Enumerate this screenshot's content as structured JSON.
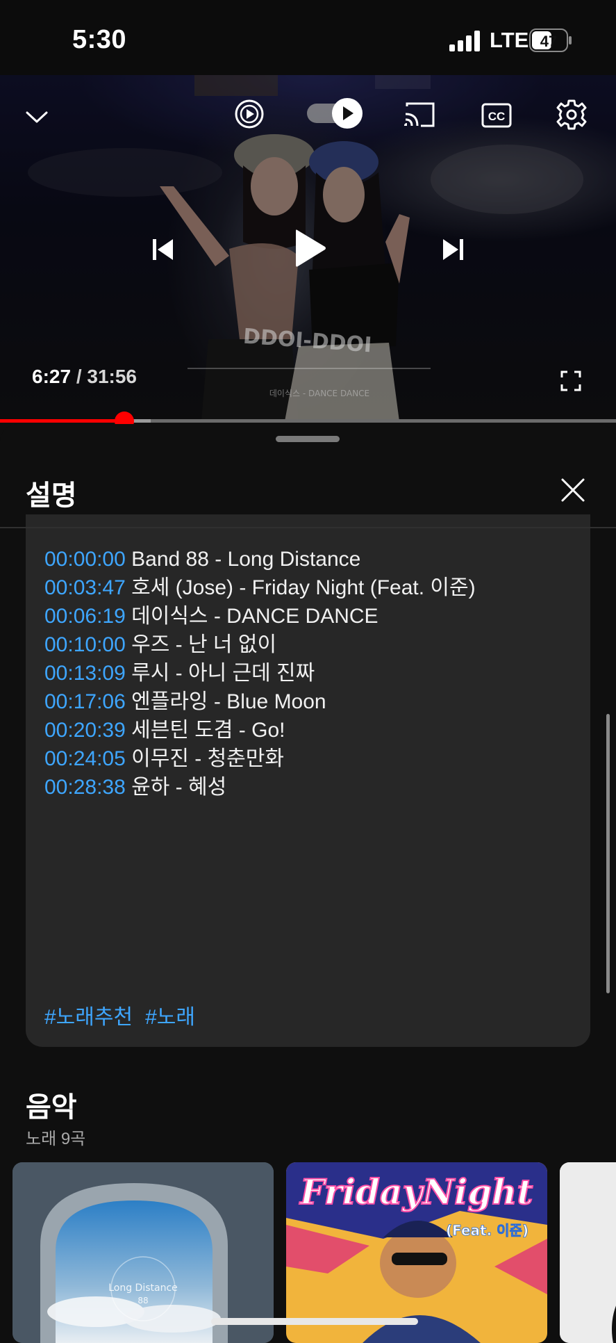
{
  "status_bar": {
    "time": "5:30",
    "network": "LTE",
    "battery": "47"
  },
  "player": {
    "current_time": "6:27",
    "separator": "/",
    "duration": "31:56",
    "progress_fraction": 0.202,
    "buffered_fraction": 0.245,
    "watermark_title": "DDOI-DDOI",
    "watermark_subtitle": "데이식스 - DANCE DANCE",
    "icons": {
      "collapse": "chevron-down-icon",
      "autoplay": "autoplay-icon",
      "autoplay_toggle": "toggle-play-icon",
      "cast": "cast-icon",
      "captions": "cc-icon",
      "settings": "gear-icon",
      "previous": "skip-previous-icon",
      "play": "play-icon",
      "next": "skip-next-icon",
      "fullscreen": "fullscreen-icon"
    },
    "accent_color": "#ff0000"
  },
  "description_panel": {
    "title": "설명",
    "tracks": [
      {
        "timestamp": "00:00:00",
        "title": "Band 88 - Long Distance"
      },
      {
        "timestamp": "00:03:47",
        "title": "호세 (Jose) - Friday Night (Feat. 이준)"
      },
      {
        "timestamp": "00:06:19",
        "title": "데이식스 - DANCE DANCE"
      },
      {
        "timestamp": "00:10:00",
        "title": "우즈 - 난 너 없이"
      },
      {
        "timestamp": "00:13:09",
        "title": "루시 - 아니 근데 진짜"
      },
      {
        "timestamp": "00:17:06",
        "title": "엔플라잉 - Blue Moon"
      },
      {
        "timestamp": "00:20:39",
        "title": "세븐틴 도겸 - Go!"
      },
      {
        "timestamp": "00:24:05",
        "title": "이무진 - 청춘만화"
      },
      {
        "timestamp": "00:28:38",
        "title": "윤하 - 혜성"
      }
    ],
    "hashtags": [
      "#노래추천",
      "#노래"
    ],
    "link_color": "#3ea6ff"
  },
  "music_section": {
    "title": "음악",
    "subtitle": "노래 9곡",
    "cards": [
      {
        "art_text": "Long Distance",
        "art_subtext": "88"
      },
      {
        "art_text": "FridayNight",
        "art_subtext": "(Feat. 이준)"
      }
    ]
  }
}
